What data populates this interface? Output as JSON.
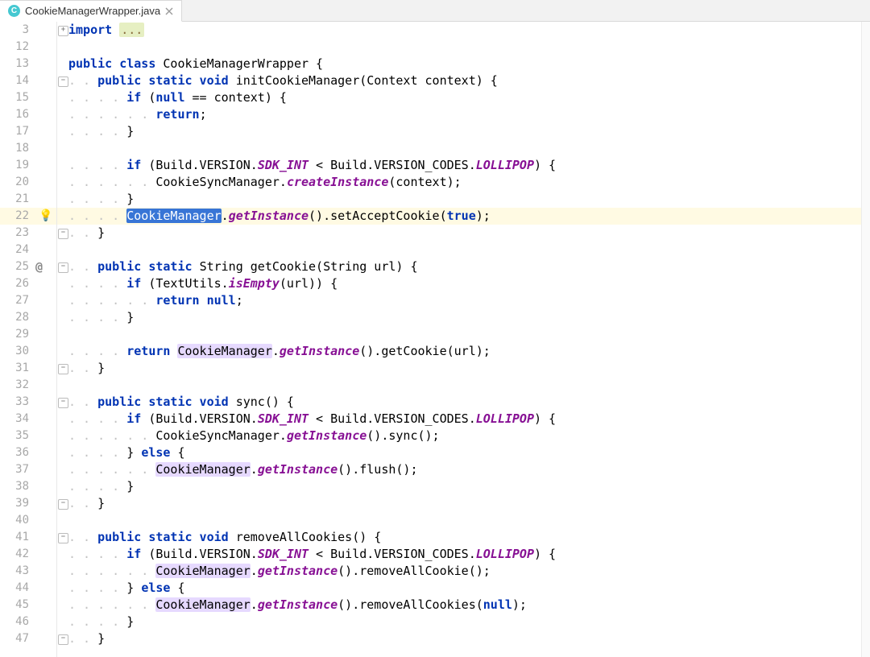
{
  "tab": {
    "filename": "CookieManagerWrapper.java",
    "badge_letter": "C"
  },
  "line_start_offsets": [
    3,
    12,
    13,
    14,
    15,
    16,
    17,
    18,
    19,
    20,
    21,
    22,
    23,
    24,
    25,
    26,
    27,
    28,
    29,
    30,
    31,
    32,
    33,
    34,
    35,
    36,
    37,
    38,
    39,
    40,
    41,
    42,
    43,
    44,
    45,
    46,
    47
  ],
  "highlighted_line": 22,
  "gutter_at_line": 25,
  "bulb_line": 22,
  "code": {
    "3": {
      "indent": 0,
      "tokens": [
        [
          "kw",
          "import "
        ],
        [
          "mu bg-fold",
          "..."
        ]
      ]
    },
    "12": {
      "indent": 0,
      "tokens": []
    },
    "13": {
      "indent": 0,
      "tokens": [
        [
          "kw",
          "public class "
        ],
        [
          "",
          "CookieManagerWrapper {"
        ]
      ]
    },
    "14": {
      "indent": 1,
      "tokens": [
        [
          "kw",
          "public static void "
        ],
        [
          "",
          "initCookieManager(Context context) {"
        ]
      ]
    },
    "15": {
      "indent": 2,
      "tokens": [
        [
          "kw",
          "if "
        ],
        [
          "",
          "("
        ],
        [
          "kw",
          "null"
        ],
        [
          "",
          " == context) {"
        ]
      ]
    },
    "16": {
      "indent": 3,
      "tokens": [
        [
          "kw",
          "return"
        ],
        [
          "",
          ";"
        ]
      ]
    },
    "17": {
      "indent": 2,
      "tokens": [
        [
          "",
          "}"
        ]
      ]
    },
    "18": {
      "indent": 0,
      "tokens": []
    },
    "19": {
      "indent": 2,
      "tokens": [
        [
          "kw",
          "if "
        ],
        [
          "",
          "(Build.VERSION."
        ],
        [
          "si",
          "SDK_INT"
        ],
        [
          "",
          " < Build.VERSION_CODES."
        ],
        [
          "si",
          "LOLLIPOP"
        ],
        [
          "",
          ") {"
        ]
      ]
    },
    "20": {
      "indent": 3,
      "tokens": [
        [
          "",
          "CookieSyncManager."
        ],
        [
          "si",
          "createInstance"
        ],
        [
          "",
          "(context);"
        ]
      ]
    },
    "21": {
      "indent": 2,
      "tokens": [
        [
          "",
          "}"
        ]
      ]
    },
    "22": {
      "indent": 2,
      "tokens": [
        [
          "hl-sel",
          "CookieManager"
        ],
        [
          "",
          "."
        ],
        [
          "si",
          "getInstance"
        ],
        [
          "",
          "().setAcceptCookie("
        ],
        [
          "kw",
          "true"
        ],
        [
          "",
          ");"
        ]
      ]
    },
    "23": {
      "indent": 1,
      "tokens": [
        [
          "",
          "}"
        ]
      ]
    },
    "24": {
      "indent": 0,
      "tokens": []
    },
    "25": {
      "indent": 1,
      "tokens": [
        [
          "kw",
          "public static "
        ],
        [
          "",
          "String getCookie(String url) {"
        ]
      ]
    },
    "26": {
      "indent": 2,
      "tokens": [
        [
          "kw",
          "if "
        ],
        [
          "",
          "(TextUtils."
        ],
        [
          "si",
          "isEmpty"
        ],
        [
          "",
          "(url)) {"
        ]
      ]
    },
    "27": {
      "indent": 3,
      "tokens": [
        [
          "kw",
          "return null"
        ],
        [
          "",
          ";"
        ]
      ]
    },
    "28": {
      "indent": 2,
      "tokens": [
        [
          "",
          "}"
        ]
      ]
    },
    "29": {
      "indent": 0,
      "tokens": []
    },
    "30": {
      "indent": 2,
      "tokens": [
        [
          "kw",
          "return "
        ],
        [
          "hl-use",
          "CookieManager"
        ],
        [
          "",
          "."
        ],
        [
          "si",
          "getInstance"
        ],
        [
          "",
          "().getCookie(url);"
        ]
      ]
    },
    "31": {
      "indent": 1,
      "tokens": [
        [
          "",
          "}"
        ]
      ]
    },
    "32": {
      "indent": 0,
      "tokens": []
    },
    "33": {
      "indent": 1,
      "tokens": [
        [
          "kw",
          "public static void "
        ],
        [
          "",
          "sync() {"
        ]
      ]
    },
    "34": {
      "indent": 2,
      "tokens": [
        [
          "kw",
          "if "
        ],
        [
          "",
          "(Build.VERSION."
        ],
        [
          "si",
          "SDK_INT"
        ],
        [
          "",
          " < Build.VERSION_CODES."
        ],
        [
          "si",
          "LOLLIPOP"
        ],
        [
          "",
          ") {"
        ]
      ]
    },
    "35": {
      "indent": 3,
      "tokens": [
        [
          "",
          "CookieSyncManager."
        ],
        [
          "si",
          "getInstance"
        ],
        [
          "",
          "().sync();"
        ]
      ]
    },
    "36": {
      "indent": 2,
      "tokens": [
        [
          "",
          "} "
        ],
        [
          "kw",
          "else"
        ],
        [
          "",
          " {"
        ]
      ]
    },
    "37": {
      "indent": 3,
      "tokens": [
        [
          "hl-use",
          "CookieManager"
        ],
        [
          "",
          "."
        ],
        [
          "si",
          "getInstance"
        ],
        [
          "",
          "().flush();"
        ]
      ]
    },
    "38": {
      "indent": 2,
      "tokens": [
        [
          "",
          "}"
        ]
      ]
    },
    "39": {
      "indent": 1,
      "tokens": [
        [
          "",
          "}"
        ]
      ]
    },
    "40": {
      "indent": 0,
      "tokens": []
    },
    "41": {
      "indent": 1,
      "tokens": [
        [
          "kw",
          "public static void "
        ],
        [
          "",
          "removeAllCookies() {"
        ]
      ]
    },
    "42": {
      "indent": 2,
      "tokens": [
        [
          "kw",
          "if "
        ],
        [
          "",
          "(Build.VERSION."
        ],
        [
          "si",
          "SDK_INT"
        ],
        [
          "",
          " < Build.VERSION_CODES."
        ],
        [
          "si",
          "LOLLIPOP"
        ],
        [
          "",
          ") {"
        ]
      ]
    },
    "43": {
      "indent": 3,
      "tokens": [
        [
          "hl-use",
          "CookieManager"
        ],
        [
          "",
          "."
        ],
        [
          "si",
          "getInstance"
        ],
        [
          "",
          "().removeAllCookie();"
        ]
      ]
    },
    "44": {
      "indent": 2,
      "tokens": [
        [
          "",
          "} "
        ],
        [
          "kw",
          "else"
        ],
        [
          "",
          " {"
        ]
      ]
    },
    "45": {
      "indent": 3,
      "tokens": [
        [
          "hl-use",
          "CookieManager"
        ],
        [
          "",
          "."
        ],
        [
          "si",
          "getInstance"
        ],
        [
          "",
          "().removeAllCookies("
        ],
        [
          "kw",
          "null"
        ],
        [
          "",
          ");"
        ]
      ]
    },
    "46": {
      "indent": 2,
      "tokens": [
        [
          "",
          "}"
        ]
      ]
    },
    "47": {
      "indent": 1,
      "tokens": [
        [
          "",
          "}"
        ]
      ]
    }
  },
  "fold_glyphs": {
    "3": "+",
    "14": "-",
    "23": "-",
    "25": "-",
    "31": "-",
    "33": "-",
    "39": "-",
    "41": "-",
    "47": "-"
  }
}
